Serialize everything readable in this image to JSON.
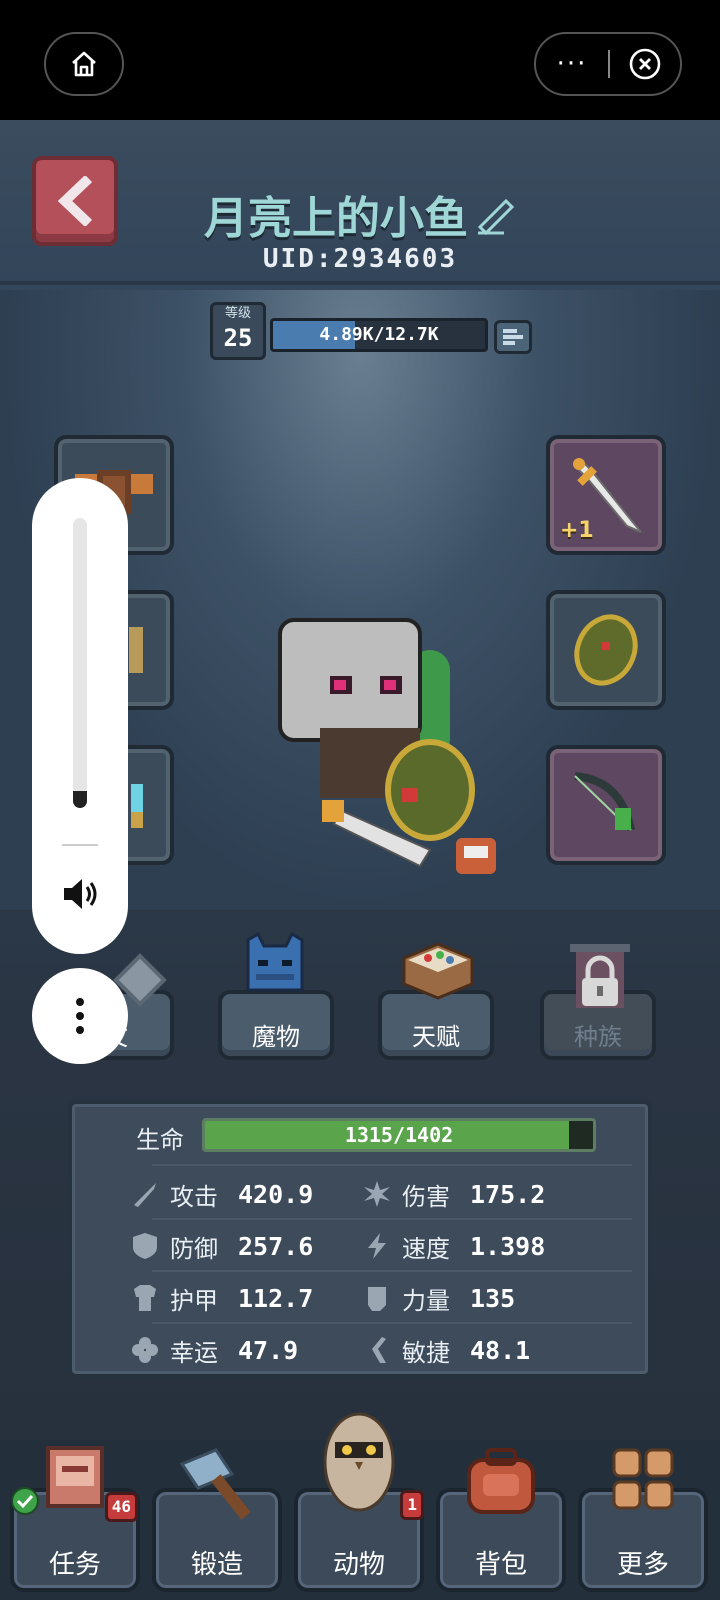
{
  "system_bar": {
    "home_icon": "home-icon",
    "more_icon": "more-dots-icon",
    "close_icon": "close-circle-icon",
    "more_glyph": "···"
  },
  "header": {
    "player_name": "月亮上的小鱼",
    "uid": "UID:2934603",
    "back_icon": "chevron-left-icon",
    "edit_icon": "pencil-icon"
  },
  "level": {
    "label": "等级",
    "value": "25",
    "xp_text": "4.89K/12.7K",
    "xp_fraction": 0.385
  },
  "equipment": {
    "left": [
      {
        "name": "armor-chest-icon"
      },
      {
        "name": "helmet-icon"
      },
      {
        "name": "crystal-icon"
      }
    ],
    "right": [
      {
        "name": "sword-icon",
        "enhance": "+1"
      },
      {
        "name": "shield-icon"
      },
      {
        "name": "bow-icon"
      }
    ]
  },
  "volume": {
    "level": 0.06,
    "speaker_icon": "speaker-icon",
    "more_icon": "vertical-dots-icon"
  },
  "menu": [
    {
      "label": "文",
      "icon": "rune-icon",
      "locked": false
    },
    {
      "label": "魔物",
      "icon": "monster-icon",
      "locked": false
    },
    {
      "label": "天赋",
      "icon": "talent-book-icon",
      "locked": false
    },
    {
      "label": "种族",
      "icon": "lock-icon",
      "locked": true
    }
  ],
  "stats": {
    "hp_label": "生命",
    "hp_text": "1315/1402",
    "hp_fraction": 0.938,
    "items": [
      {
        "label": "攻击",
        "value": "420.9",
        "icon": "sword-stat-icon"
      },
      {
        "label": "伤害",
        "value": "175.2",
        "icon": "burst-icon"
      },
      {
        "label": "防御",
        "value": "257.6",
        "icon": "shield-stat-icon"
      },
      {
        "label": "速度",
        "value": "1.398",
        "icon": "lightning-icon"
      },
      {
        "label": "护甲",
        "value": "112.7",
        "icon": "armor-stat-icon"
      },
      {
        "label": "力量",
        "value": "135",
        "icon": "fist-icon"
      },
      {
        "label": "幸运",
        "value": "47.9",
        "icon": "clover-icon"
      },
      {
        "label": "敏捷",
        "value": "48.1",
        "icon": "boot-icon"
      }
    ]
  },
  "bottom_nav": [
    {
      "label": "任务",
      "icon": "quest-board-icon",
      "badge": "46",
      "check": true
    },
    {
      "label": "锻造",
      "icon": "hammer-icon"
    },
    {
      "label": "动物",
      "icon": "owl-icon",
      "badge": "1"
    },
    {
      "label": "背包",
      "icon": "backpack-icon"
    },
    {
      "label": "更多",
      "icon": "grid-more-icon"
    }
  ]
}
